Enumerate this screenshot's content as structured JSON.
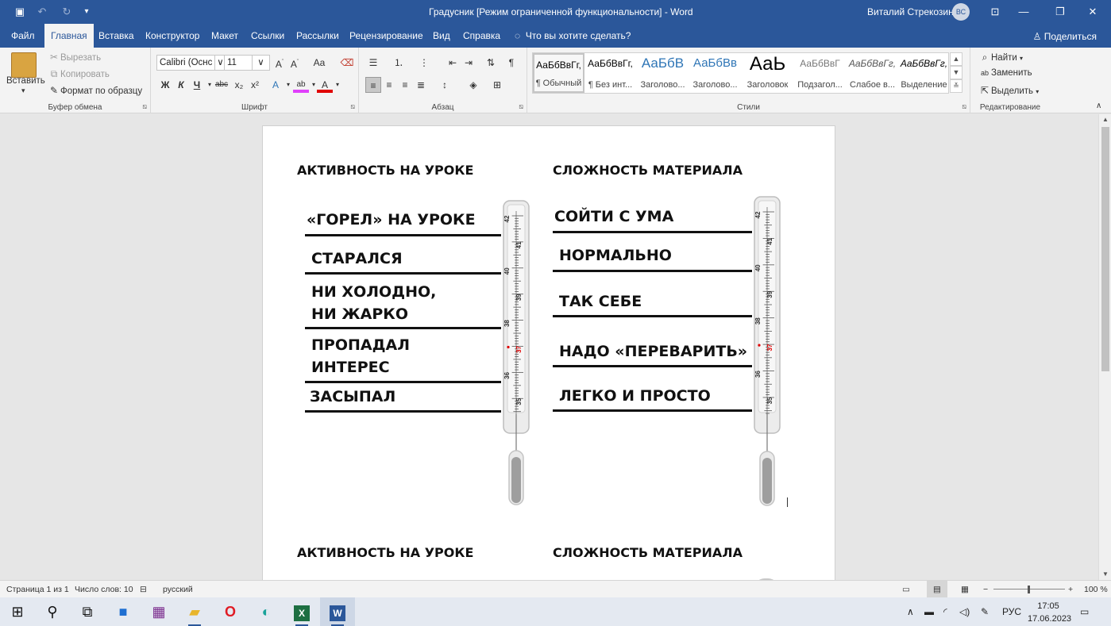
{
  "window": {
    "title": "Градусник [Режим ограниченной функциональности]  -  Word",
    "user_name": "Виталий Стрекозин",
    "user_initials": "ВС"
  },
  "menu_tabs": [
    "Файл",
    "Главная",
    "Вставка",
    "Конструктор",
    "Макет",
    "Ссылки",
    "Рассылки",
    "Рецензирование",
    "Вид",
    "Справка"
  ],
  "tell_me": "Что вы хотите сделать?",
  "share_label": "Поделиться",
  "ribbon": {
    "clipboard": {
      "paste": "Вставить",
      "cut": "Вырезать",
      "copy": "Копировать",
      "format_painter": "Формат по образцу",
      "label": "Буфер обмена"
    },
    "font": {
      "family": "Calibri (Оснс",
      "size": "11",
      "bold": "Ж",
      "italic": "К",
      "underline": "Ч",
      "strike": "abc",
      "subscript": "x₂",
      "superscript": "x²",
      "change_case": "Aa",
      "label": "Шрифт"
    },
    "paragraph": {
      "label": "Абзац"
    },
    "styles": {
      "label": "Стили",
      "items": [
        {
          "sample": "АаБбВвГг,",
          "name": "¶ Обычный"
        },
        {
          "sample": "АаБбВвГг,",
          "name": "¶ Без инт..."
        },
        {
          "sample": "АаБбВ",
          "name": "Заголово..."
        },
        {
          "sample": "АаБбВв",
          "name": "Заголово..."
        },
        {
          "sample": "АаЬ",
          "name": "Заголовок"
        },
        {
          "sample": "АаБбВвГ",
          "name": "Подзагол..."
        },
        {
          "sample": "АаБбВвГг,",
          "name": "Слабое в..."
        },
        {
          "sample": "АаБбВвГг,",
          "name": "Выделение"
        }
      ]
    },
    "editing": {
      "find": "Найти",
      "replace": "Заменить",
      "select": "Выделить",
      "label": "Редактирование"
    }
  },
  "document": {
    "left": {
      "heading": "АКТИВНОСТЬ НА УРОКЕ",
      "rows": [
        [
          "«ГОРЕЛ» НА УРОКЕ"
        ],
        [
          "СТАРАЛСЯ"
        ],
        [
          "НИ ХОЛОДНО,",
          "НИ ЖАРКО"
        ],
        [
          "ПРОПАДАЛ",
          "ИНТЕРЕС"
        ],
        [
          "ЗАСЫПАЛ"
        ]
      ]
    },
    "right": {
      "heading": "СЛОЖНОСТЬ МАТЕРИАЛА",
      "rows": [
        [
          "СОЙТИ С УМА"
        ],
        [
          "НОРМАЛЬНО"
        ],
        [
          "ТАК СЕБЕ"
        ],
        [
          "НАДО «ПЕРЕВАРИТЬ»"
        ],
        [
          "ЛЕГКО И ПРОСТО"
        ]
      ]
    },
    "thermometer_scale": [
      "42",
      "41",
      "40",
      "39",
      "38",
      "37",
      "36",
      "35"
    ],
    "second_left_heading": "АКТИВНОСТЬ НА УРОКЕ",
    "second_right_heading": "СЛОЖНОСТЬ МАТЕРИАЛА"
  },
  "status": {
    "page": "Страница 1 из 1",
    "words": "Число слов: 10",
    "language": "русский",
    "zoom": "100 %"
  },
  "taskbar": {
    "lang": "РУС",
    "time": "17:05",
    "date": "17.06.2023"
  }
}
